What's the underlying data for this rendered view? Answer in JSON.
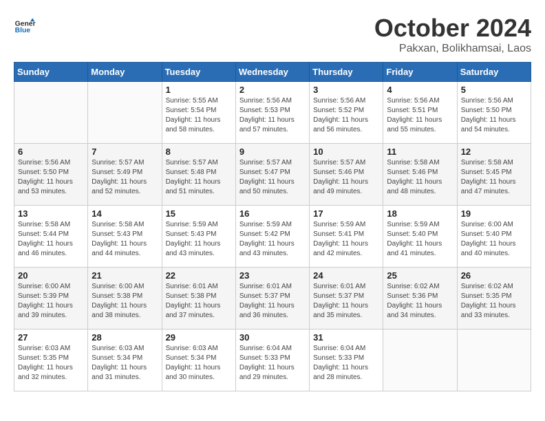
{
  "header": {
    "logo_general": "General",
    "logo_blue": "Blue",
    "title": "October 2024",
    "location": "Pakxan, Bolikhamsai, Laos"
  },
  "calendar": {
    "days_of_week": [
      "Sunday",
      "Monday",
      "Tuesday",
      "Wednesday",
      "Thursday",
      "Friday",
      "Saturday"
    ],
    "weeks": [
      [
        {
          "day": "",
          "info": ""
        },
        {
          "day": "",
          "info": ""
        },
        {
          "day": "1",
          "info": "Sunrise: 5:55 AM\nSunset: 5:54 PM\nDaylight: 11 hours and 58 minutes."
        },
        {
          "day": "2",
          "info": "Sunrise: 5:56 AM\nSunset: 5:53 PM\nDaylight: 11 hours and 57 minutes."
        },
        {
          "day": "3",
          "info": "Sunrise: 5:56 AM\nSunset: 5:52 PM\nDaylight: 11 hours and 56 minutes."
        },
        {
          "day": "4",
          "info": "Sunrise: 5:56 AM\nSunset: 5:51 PM\nDaylight: 11 hours and 55 minutes."
        },
        {
          "day": "5",
          "info": "Sunrise: 5:56 AM\nSunset: 5:50 PM\nDaylight: 11 hours and 54 minutes."
        }
      ],
      [
        {
          "day": "6",
          "info": "Sunrise: 5:56 AM\nSunset: 5:50 PM\nDaylight: 11 hours and 53 minutes."
        },
        {
          "day": "7",
          "info": "Sunrise: 5:57 AM\nSunset: 5:49 PM\nDaylight: 11 hours and 52 minutes."
        },
        {
          "day": "8",
          "info": "Sunrise: 5:57 AM\nSunset: 5:48 PM\nDaylight: 11 hours and 51 minutes."
        },
        {
          "day": "9",
          "info": "Sunrise: 5:57 AM\nSunset: 5:47 PM\nDaylight: 11 hours and 50 minutes."
        },
        {
          "day": "10",
          "info": "Sunrise: 5:57 AM\nSunset: 5:46 PM\nDaylight: 11 hours and 49 minutes."
        },
        {
          "day": "11",
          "info": "Sunrise: 5:58 AM\nSunset: 5:46 PM\nDaylight: 11 hours and 48 minutes."
        },
        {
          "day": "12",
          "info": "Sunrise: 5:58 AM\nSunset: 5:45 PM\nDaylight: 11 hours and 47 minutes."
        }
      ],
      [
        {
          "day": "13",
          "info": "Sunrise: 5:58 AM\nSunset: 5:44 PM\nDaylight: 11 hours and 46 minutes."
        },
        {
          "day": "14",
          "info": "Sunrise: 5:58 AM\nSunset: 5:43 PM\nDaylight: 11 hours and 44 minutes."
        },
        {
          "day": "15",
          "info": "Sunrise: 5:59 AM\nSunset: 5:43 PM\nDaylight: 11 hours and 43 minutes."
        },
        {
          "day": "16",
          "info": "Sunrise: 5:59 AM\nSunset: 5:42 PM\nDaylight: 11 hours and 43 minutes."
        },
        {
          "day": "17",
          "info": "Sunrise: 5:59 AM\nSunset: 5:41 PM\nDaylight: 11 hours and 42 minutes."
        },
        {
          "day": "18",
          "info": "Sunrise: 5:59 AM\nSunset: 5:40 PM\nDaylight: 11 hours and 41 minutes."
        },
        {
          "day": "19",
          "info": "Sunrise: 6:00 AM\nSunset: 5:40 PM\nDaylight: 11 hours and 40 minutes."
        }
      ],
      [
        {
          "day": "20",
          "info": "Sunrise: 6:00 AM\nSunset: 5:39 PM\nDaylight: 11 hours and 39 minutes."
        },
        {
          "day": "21",
          "info": "Sunrise: 6:00 AM\nSunset: 5:38 PM\nDaylight: 11 hours and 38 minutes."
        },
        {
          "day": "22",
          "info": "Sunrise: 6:01 AM\nSunset: 5:38 PM\nDaylight: 11 hours and 37 minutes."
        },
        {
          "day": "23",
          "info": "Sunrise: 6:01 AM\nSunset: 5:37 PM\nDaylight: 11 hours and 36 minutes."
        },
        {
          "day": "24",
          "info": "Sunrise: 6:01 AM\nSunset: 5:37 PM\nDaylight: 11 hours and 35 minutes."
        },
        {
          "day": "25",
          "info": "Sunrise: 6:02 AM\nSunset: 5:36 PM\nDaylight: 11 hours and 34 minutes."
        },
        {
          "day": "26",
          "info": "Sunrise: 6:02 AM\nSunset: 5:35 PM\nDaylight: 11 hours and 33 minutes."
        }
      ],
      [
        {
          "day": "27",
          "info": "Sunrise: 6:03 AM\nSunset: 5:35 PM\nDaylight: 11 hours and 32 minutes."
        },
        {
          "day": "28",
          "info": "Sunrise: 6:03 AM\nSunset: 5:34 PM\nDaylight: 11 hours and 31 minutes."
        },
        {
          "day": "29",
          "info": "Sunrise: 6:03 AM\nSunset: 5:34 PM\nDaylight: 11 hours and 30 minutes."
        },
        {
          "day": "30",
          "info": "Sunrise: 6:04 AM\nSunset: 5:33 PM\nDaylight: 11 hours and 29 minutes."
        },
        {
          "day": "31",
          "info": "Sunrise: 6:04 AM\nSunset: 5:33 PM\nDaylight: 11 hours and 28 minutes."
        },
        {
          "day": "",
          "info": ""
        },
        {
          "day": "",
          "info": ""
        }
      ]
    ]
  }
}
